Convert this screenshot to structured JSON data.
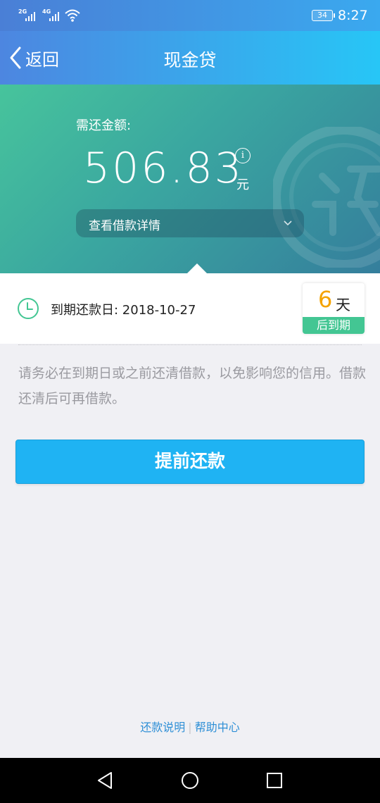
{
  "status_bar": {
    "signal1_tag": "2G",
    "signal2_tag": "4G",
    "battery": "34",
    "time": "8:27"
  },
  "nav": {
    "back_label": "返回",
    "title": "现金贷"
  },
  "hero": {
    "due_label": "需还金额:",
    "amount": "506.83",
    "info_icon_glyph": "i",
    "unit": "元",
    "details_label": "查看借款详情"
  },
  "due": {
    "date_text": "到期还款日: 2018-10-27",
    "days_number": "6",
    "days_unit": "天",
    "days_suffix": "后到期"
  },
  "notice": {
    "text": "请务必在到期日或之前还清借款，以免影响您的信用。借款还清后可再借款。"
  },
  "actions": {
    "repay_early": "提前还款"
  },
  "footer": {
    "repay_info": "还款说明",
    "separator": "|",
    "help_center": "帮助中心"
  },
  "colors": {
    "accent": "#1fb3f3",
    "hero_start": "#47c49c",
    "hero_end": "#357e9c",
    "badge_green": "#43c693",
    "days_orange": "#f5a300",
    "link_blue": "#2e8fd6"
  },
  "icons": {
    "back": "chevron-left-icon",
    "info": "info-icon",
    "dropdown": "chevron-down-icon",
    "clock": "clock-icon",
    "watermark": "repay-seal-watermark",
    "sys_back": "triangle-back-icon",
    "sys_home": "circle-home-icon",
    "sys_recent": "square-recent-icon"
  }
}
